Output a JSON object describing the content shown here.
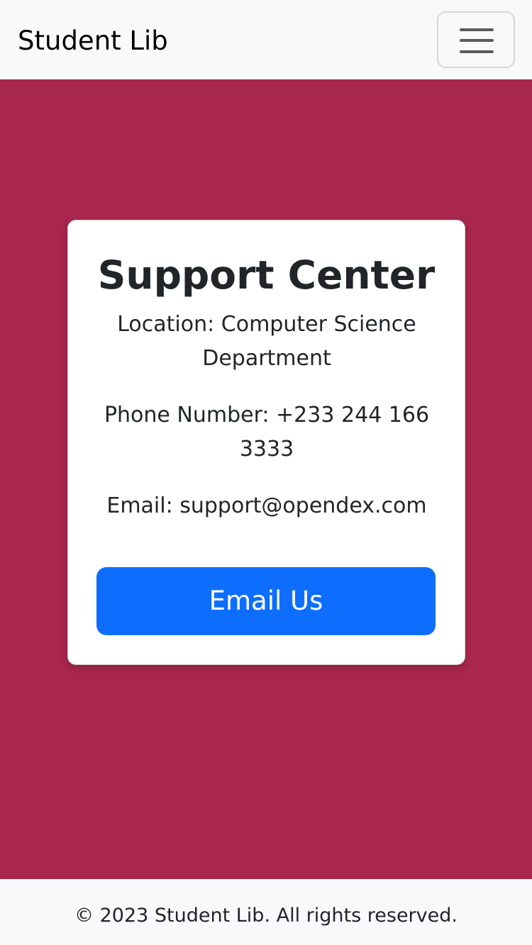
{
  "navbar": {
    "brand": "Student Lib",
    "toggler_icon": "hamburger-menu-icon"
  },
  "colors": {
    "navbar_bg": "#f8f9fa",
    "main_bg": "#a9264d",
    "card_bg": "#ffffff",
    "button_bg": "#0d6efd",
    "footer_bg": "#f8f9fa"
  },
  "support_card": {
    "title": "Support Center",
    "location": "Location: Computer Science Department",
    "phone": "Phone Number: +233 244 166 3333",
    "email": "Email: support@opendex.com",
    "button_label": "Email Us"
  },
  "footer": {
    "copyright": "© 2023 Student Lib. All rights reserved."
  }
}
